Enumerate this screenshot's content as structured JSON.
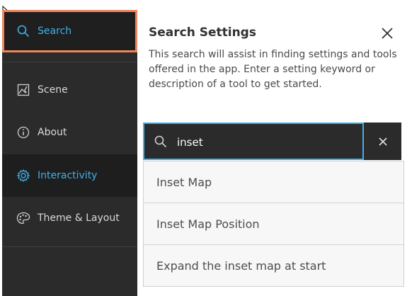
{
  "sidebar": {
    "items": [
      {
        "label": "Search",
        "icon": "search-icon"
      },
      {
        "label": "Scene",
        "icon": "scene-icon"
      },
      {
        "label": "About",
        "icon": "info-icon"
      },
      {
        "label": "Interactivity",
        "icon": "gear-icon"
      },
      {
        "label": "Theme & Layout",
        "icon": "palette-icon"
      }
    ]
  },
  "panel": {
    "title": "Search Settings",
    "description": "This search will assist in finding settings and tools offered in the app. Enter a setting keyword or description of a tool to get started."
  },
  "search": {
    "value": "inset"
  },
  "results": [
    "Inset Map",
    "Inset Map Position",
    "Expand the inset map at start"
  ],
  "colors": {
    "accent": "#3fb1e8",
    "focus_outline": "#f0855a",
    "sidebar_bg": "#2b2b2b"
  }
}
